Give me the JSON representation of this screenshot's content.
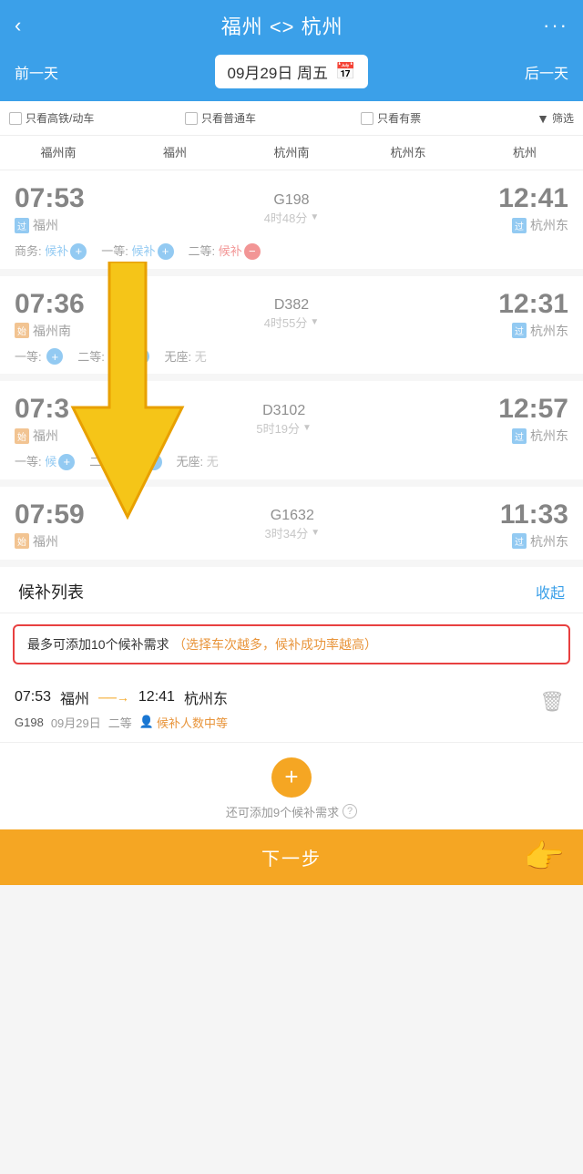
{
  "header": {
    "back_label": "‹",
    "title": "福州 <> 杭州",
    "more_label": "···"
  },
  "date_bar": {
    "prev_label": "前一天",
    "next_label": "后一天",
    "date_value": "09月29日 周五",
    "calendar_icon": "📅"
  },
  "filters": {
    "high_speed": "只看高铁/动车",
    "normal": "只看普通车",
    "available": "只看有票",
    "filter_label": "筛选"
  },
  "station_tabs": [
    "福州南",
    "福州",
    "杭州南",
    "杭州东",
    "杭州"
  ],
  "trains": [
    {
      "depart_time": "07:53",
      "depart_station": "福州",
      "depart_badge": "过",
      "depart_badge_type": "guo",
      "train_no": "G198",
      "duration": "4时48分",
      "arrive_time": "12:41",
      "arrive_station": "杭州东",
      "arrive_badge": "过",
      "arrive_badge_type": "guo",
      "tickets": [
        {
          "class": "商务:",
          "status": "候补",
          "add": true
        },
        {
          "class": "一等:",
          "status": "候补",
          "add": true
        },
        {
          "class": "二等:",
          "status": "候补",
          "remove": true
        }
      ]
    },
    {
      "depart_time": "07:36",
      "depart_station": "福州南",
      "depart_badge": "始",
      "depart_badge_type": "shi",
      "train_no": "D382",
      "duration": "4时55分",
      "arrive_time": "12:31",
      "arrive_station": "杭州东",
      "arrive_badge": "过",
      "arrive_badge_type": "guo",
      "tickets": [
        {
          "class": "一等:",
          "status": "",
          "add": true
        },
        {
          "class": "二等:",
          "status": "候补",
          "add": true
        },
        {
          "class": "无座:",
          "status": "无",
          "no_seat": true
        }
      ]
    },
    {
      "depart_time": "07:3",
      "depart_station": "福州",
      "depart_badge": "始",
      "depart_badge_type": "shi",
      "train_no": "D3102",
      "duration": "5时19分",
      "arrive_time": "12:57",
      "arrive_station": "杭州东",
      "arrive_badge": "过",
      "arrive_badge_type": "guo",
      "tickets": [
        {
          "class": "一等:",
          "status": "候",
          "add": true
        },
        {
          "class": "二等:",
          "status": "候补",
          "add": true
        },
        {
          "class": "无座:",
          "status": "无",
          "no_seat": true
        }
      ]
    },
    {
      "depart_time": "07:59",
      "depart_station": "福州",
      "depart_badge": "始",
      "depart_badge_type": "shi",
      "train_no": "G1632",
      "duration": "3时34分",
      "arrive_time": "11:33",
      "arrive_station": "杭州东",
      "arrive_badge": "过",
      "arrive_badge_type": "guo",
      "tickets": []
    }
  ],
  "panel": {
    "title": "候补列表",
    "collapse_label": "收起"
  },
  "notice": {
    "main": "最多可添加10个候补需求",
    "highlight": "（选择车次越多，候补成功率越高）"
  },
  "booking_item": {
    "depart_time": "07:53",
    "depart_station": "福州",
    "arrive_time": "12:41",
    "arrive_station": "杭州东",
    "train_no": "G198",
    "date": "09月29日",
    "seat_class": "二等",
    "waitlist_label": "候补人数中等",
    "person_icon": "👤"
  },
  "add_section": {
    "plus_label": "+",
    "hint": "还可添加9个候补需求",
    "hint_icon": "?"
  },
  "bottom_bar": {
    "label": "下一步"
  }
}
